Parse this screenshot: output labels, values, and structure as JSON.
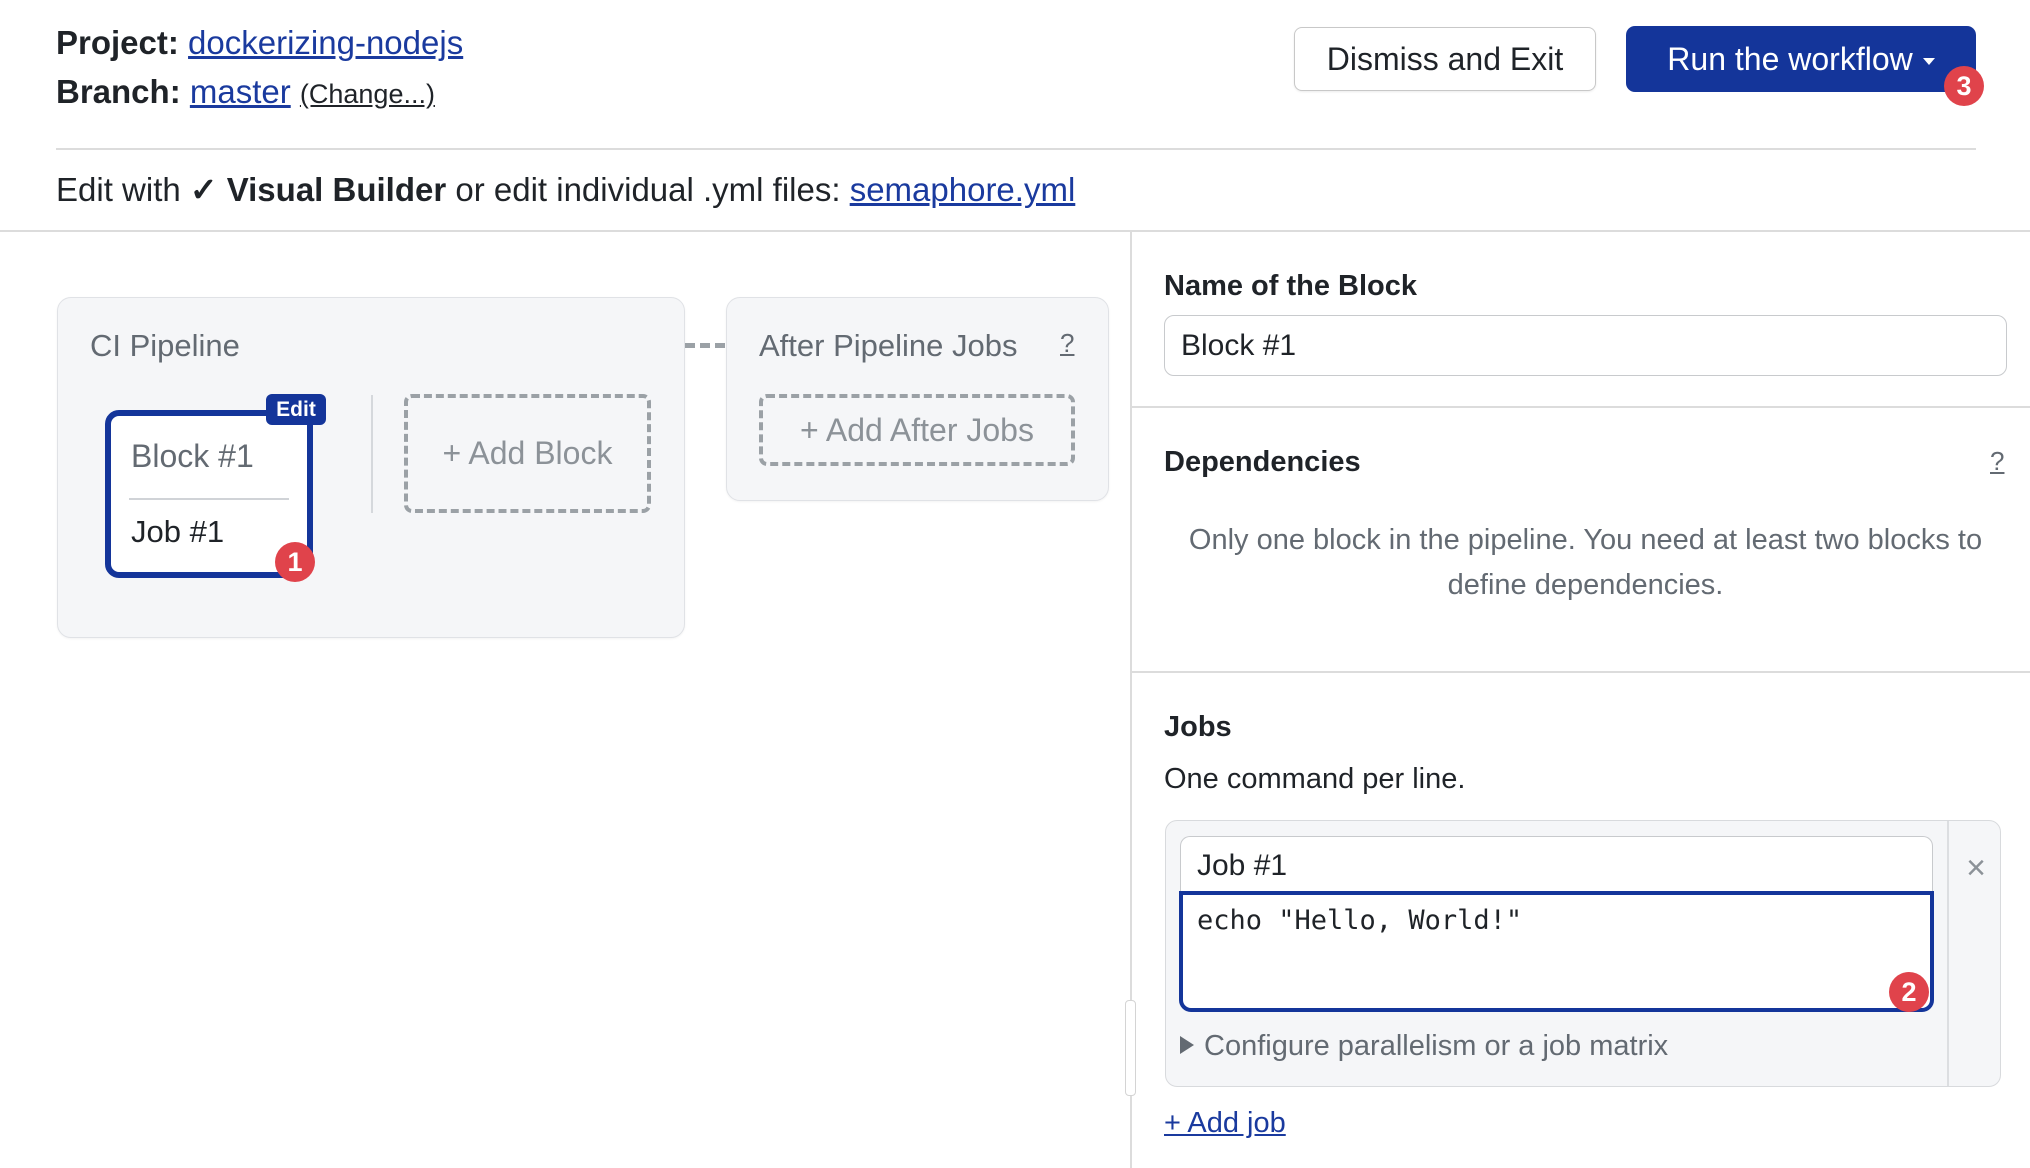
{
  "header": {
    "project_label": "Project:",
    "project_name": "dockerizing-nodejs",
    "branch_label": "Branch:",
    "branch_name": "master",
    "change_link": "(Change...)",
    "dismiss_button": "Dismiss and Exit",
    "run_button": "Run the workflow",
    "run_badge": "3"
  },
  "edit_mode": {
    "prefix": "Edit with",
    "checkmark": "✓",
    "active_mode": "Visual Builder",
    "middle": "or edit individual .yml files:",
    "file_link": "semaphore.yml"
  },
  "pipeline": {
    "title": "CI Pipeline",
    "blocks": [
      {
        "name": "Block #1",
        "jobs": [
          "Job #1"
        ],
        "edit_tag": "Edit",
        "badge": "1"
      }
    ],
    "add_block": "+ Add Block"
  },
  "after_pipeline": {
    "title": "After Pipeline Jobs",
    "help": "?",
    "add_button": "+ Add After Jobs"
  },
  "block_editor": {
    "name_label": "Name of the Block",
    "name_value": "Block #1",
    "dependencies_label": "Dependencies",
    "dependencies_help": "?",
    "dependencies_message": "Only one block in the pipeline. You need at least two blocks to define dependencies.",
    "jobs_label": "Jobs",
    "jobs_subtitle": "One command per line.",
    "jobs": [
      {
        "name": "Job #1",
        "commands": "echo \"Hello, World!\"",
        "badge": "2"
      }
    ],
    "configure_link": "Configure parallelism or a job matrix",
    "add_job": "+ Add job",
    "remove_icon": "×"
  },
  "colors": {
    "brand": "#14359a",
    "badge": "#e0434b",
    "link": "#1a3a9e",
    "muted": "#636a72"
  }
}
